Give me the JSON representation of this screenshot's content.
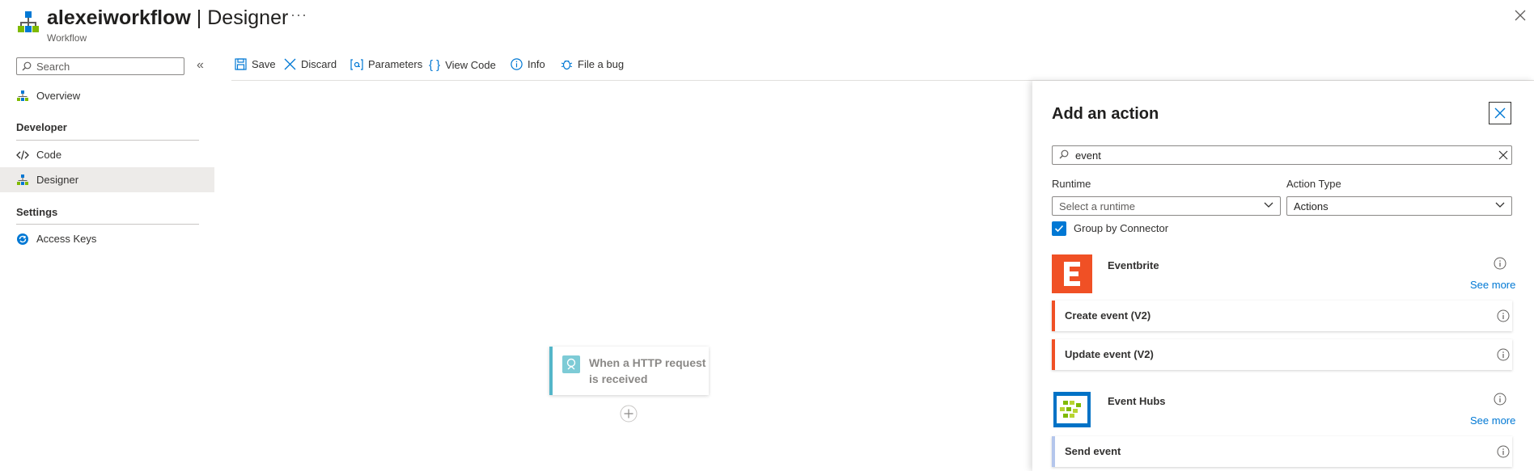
{
  "header": {
    "title_app": "alexeiworkflow",
    "title_sep": " | ",
    "title_page": "Designer",
    "subtitle": "Workflow",
    "more": "···"
  },
  "sidebar": {
    "search_placeholder": "Search",
    "collapse": "«",
    "items": [
      {
        "label": "Overview"
      },
      {
        "label": "Code"
      },
      {
        "label": "Designer"
      },
      {
        "label": "Access Keys"
      }
    ],
    "sections": [
      "Developer",
      "Settings"
    ]
  },
  "toolbar": {
    "save": "Save",
    "discard": "Discard",
    "parameters": "Parameters",
    "view_code": "View Code",
    "info": "Info",
    "file_bug": "File a bug"
  },
  "canvas": {
    "trigger_label": "When a HTTP request is received"
  },
  "panel": {
    "title": "Add an action",
    "search_value": "event",
    "runtime_label": "Runtime",
    "runtime_value": "Select a runtime",
    "action_type_label": "Action Type",
    "action_type_value": "Actions",
    "group_by_label": "Group by Connector",
    "group_by_checked": true,
    "connectors": [
      {
        "name": "Eventbrite",
        "see_more": "See more",
        "color": "#f05025",
        "actions": [
          "Create event (V2)",
          "Update event (V2)"
        ]
      },
      {
        "name": "Event Hubs",
        "see_more": "See more",
        "color": "#0072c6",
        "actions": [
          "Send event"
        ]
      }
    ]
  },
  "colors": {
    "accent": "#0078d4",
    "selected_nav": "#edebe9",
    "trigger_accent": "#54b6c9"
  }
}
